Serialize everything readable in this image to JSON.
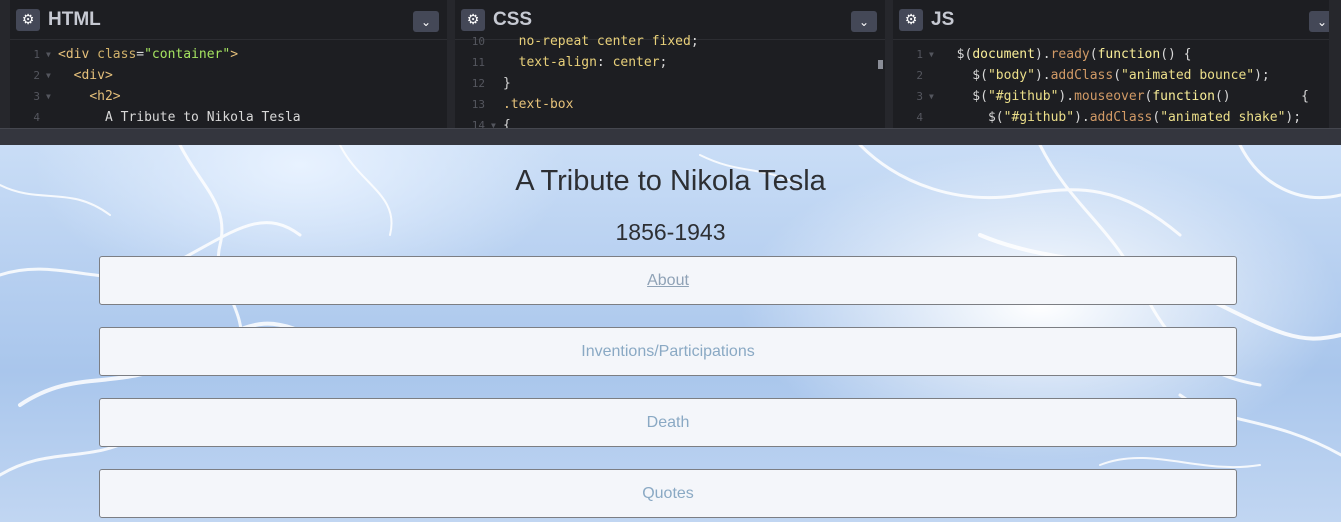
{
  "editors": [
    {
      "title": "HTML",
      "lines": [
        {
          "n": "1",
          "fold": true,
          "text": [
            [
              "tag",
              "<div "
            ],
            [
              "attr",
              "class"
            ],
            [
              "punc",
              "="
            ],
            [
              "str",
              "\"container\""
            ],
            [
              "tag",
              ">"
            ]
          ]
        },
        {
          "n": "2",
          "fold": true,
          "text": [
            [
              "punc",
              "  "
            ],
            [
              "tag",
              "<div>"
            ]
          ]
        },
        {
          "n": "3",
          "fold": true,
          "text": [
            [
              "punc",
              "    "
            ],
            [
              "tag",
              "<h2>"
            ]
          ]
        },
        {
          "n": "4",
          "fold": false,
          "text": [
            [
              "src",
              "      A Tribute to Nikola Tesla"
            ]
          ]
        }
      ]
    },
    {
      "title": "CSS",
      "lines": [
        {
          "n": "10",
          "fold": false,
          "text": [
            [
              "prop",
              "  no-repeat center fixed"
            ],
            [
              "punc",
              ";"
            ]
          ]
        },
        {
          "n": "11",
          "fold": false,
          "text": [
            [
              "prop",
              "  text-align"
            ],
            [
              "punc",
              ": "
            ],
            [
              "prop",
              "center"
            ],
            [
              "punc",
              ";"
            ]
          ]
        },
        {
          "n": "12",
          "fold": false,
          "text": [
            [
              "punc",
              "}"
            ]
          ]
        },
        {
          "n": "13",
          "fold": false,
          "text": [
            [
              "sel",
              ".text-box"
            ]
          ]
        },
        {
          "n": "14",
          "fold": true,
          "text": [
            [
              "punc",
              "{"
            ]
          ]
        }
      ]
    },
    {
      "title": "JS",
      "lines": [
        {
          "n": "1",
          "fold": true,
          "text": [
            [
              "punc",
              "  $("
            ],
            [
              "key",
              "document"
            ],
            [
              "punc",
              ")."
            ],
            [
              "fn",
              "ready"
            ],
            [
              "punc",
              "("
            ],
            [
              "key",
              "function"
            ],
            [
              "punc",
              "() {"
            ]
          ]
        },
        {
          "n": "2",
          "fold": false,
          "text": [
            [
              "punc",
              "    $("
            ],
            [
              "str2",
              "\"body\""
            ],
            [
              "punc",
              ")."
            ],
            [
              "fn",
              "addClass"
            ],
            [
              "punc",
              "("
            ],
            [
              "str2",
              "\"animated bounce\""
            ],
            [
              "punc",
              ");"
            ]
          ]
        },
        {
          "n": "3",
          "fold": true,
          "text": [
            [
              "punc",
              "    $("
            ],
            [
              "str2",
              "\"#github\""
            ],
            [
              "punc",
              ")."
            ],
            [
              "fn",
              "mouseover"
            ],
            [
              "punc",
              "("
            ],
            [
              "key",
              "function"
            ],
            [
              "punc",
              "()         {"
            ]
          ]
        },
        {
          "n": "4",
          "fold": false,
          "text": [
            [
              "punc",
              "      $("
            ],
            [
              "str2",
              "\"#github\""
            ],
            [
              "punc",
              ")."
            ],
            [
              "fn",
              "addClass"
            ],
            [
              "punc",
              "("
            ],
            [
              "str2",
              "\"animated shake\""
            ],
            [
              "punc",
              ");"
            ]
          ]
        }
      ]
    }
  ],
  "preview": {
    "title": "A Tribute to Nikola Tesla",
    "years": "1856-1943",
    "sections": [
      {
        "label": "About",
        "active": true
      },
      {
        "label": "Inventions/Participations",
        "active": false
      },
      {
        "label": "Death",
        "active": false
      },
      {
        "label": "Quotes",
        "active": false
      }
    ]
  },
  "icons": {
    "gear": "gear-icon",
    "chevron": "chevron-down-icon"
  }
}
